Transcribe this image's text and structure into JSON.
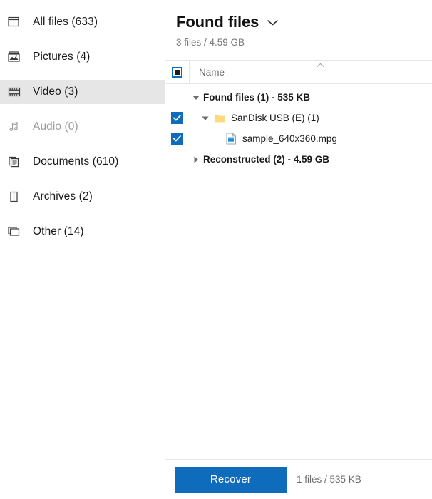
{
  "sidebar": {
    "items": [
      {
        "label": "All files (633)",
        "icon": "all-files-icon",
        "selected": false,
        "disabled": false,
        "name": "sidebar-item-all-files"
      },
      {
        "label": "Pictures (4)",
        "icon": "picture-icon",
        "selected": false,
        "disabled": false,
        "name": "sidebar-item-pictures"
      },
      {
        "label": "Video (3)",
        "icon": "film-icon",
        "selected": true,
        "disabled": false,
        "name": "sidebar-item-video"
      },
      {
        "label": "Audio (0)",
        "icon": "music-note-icon",
        "selected": false,
        "disabled": true,
        "name": "sidebar-item-audio"
      },
      {
        "label": "Documents (610)",
        "icon": "documents-icon",
        "selected": false,
        "disabled": false,
        "name": "sidebar-item-documents"
      },
      {
        "label": "Archives (2)",
        "icon": "archive-zip-icon",
        "selected": false,
        "disabled": false,
        "name": "sidebar-item-archives"
      },
      {
        "label": "Other (14)",
        "icon": "other-files-icon",
        "selected": false,
        "disabled": false,
        "name": "sidebar-item-other"
      }
    ]
  },
  "main": {
    "title": "Found files",
    "title_chevron_icon": "chevron-down-icon",
    "subtitle": "3 files / 4.59 GB",
    "columns": {
      "select_all_state": "indeterminate",
      "name_header": "Name",
      "sort_icon": "sort-ascending-caret-icon"
    },
    "tree": [
      {
        "label": "Found files (1) - 535 KB",
        "bold": true,
        "indent": 0,
        "twisty": "expanded",
        "checkbox": "none",
        "icon": "none",
        "name": "tree-row-found-files"
      },
      {
        "label": "SanDisk USB (E) (1)",
        "bold": false,
        "indent": 1,
        "twisty": "expanded",
        "checkbox": "checked",
        "icon": "folder-icon",
        "name": "tree-row-sandisk-usb"
      },
      {
        "label": "sample_640x360.mpg",
        "bold": false,
        "indent": 2,
        "twisty": "none",
        "checkbox": "checked",
        "icon": "video-file-icon",
        "name": "tree-row-sample-file"
      },
      {
        "label": "Reconstructed (2) - 4.59 GB",
        "bold": true,
        "indent": 0,
        "twisty": "collapsed",
        "checkbox": "none",
        "icon": "none",
        "name": "tree-row-reconstructed"
      }
    ]
  },
  "footer": {
    "recover_label": "Recover",
    "status": "1 files / 535 KB"
  },
  "colors": {
    "accent": "#0f6cbd",
    "selected_row": "#e6e6e6",
    "folder": "#ffcf6b",
    "muted_text": "#777777",
    "disabled_text": "#9b9b9b"
  }
}
